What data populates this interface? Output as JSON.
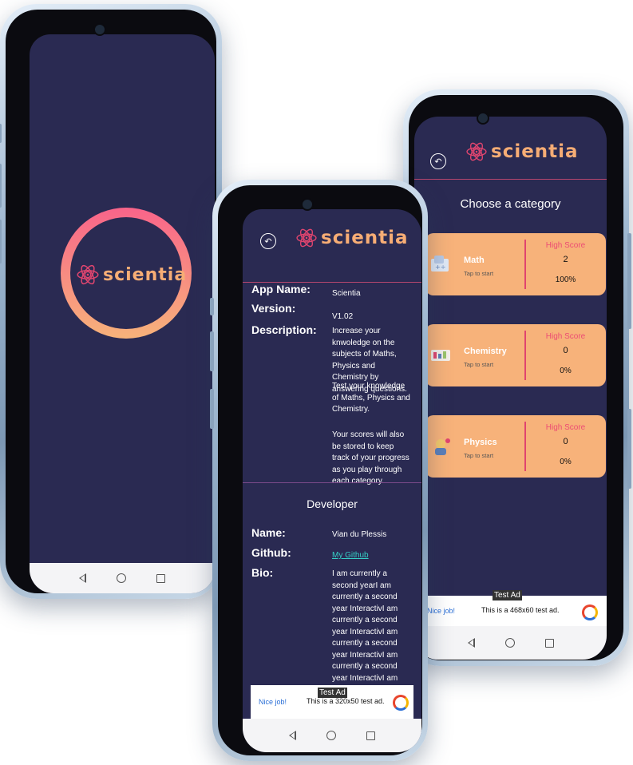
{
  "splash": {
    "logo_text": "scientia",
    "colors": {
      "background": "#2a2a52",
      "ring_start": "#f9648a",
      "ring_end": "#f7b27a",
      "logo": "#f7ad75"
    }
  },
  "info_screen": {
    "logo_text": "scientia",
    "back_icon": "back-arrow-icon",
    "fields": [
      {
        "key": "App Name:",
        "value": "Scientia"
      },
      {
        "key": "Version:",
        "value": "V1.02"
      },
      {
        "key": "Description:",
        "value": "Increase your knwoledge on the subjects of Maths, Physics and Chemistry by answering questions."
      }
    ],
    "description_p2": "Test your knowledge of Maths, Physics and Chemistry.",
    "description_p3": "Your scores will also be stored to keep track of your progress as you play through each category.",
    "developer_heading": "Developer",
    "developer": {
      "name_key": "Name:",
      "name_value": "Vian du Plessis",
      "github_key": "Github:",
      "github_value": "My Github",
      "bio_key": "Bio:",
      "bio_value": "I am currently a second yearI am currently a second year InteractivI am currently a second year InteractivI am currently a second year InteractivI am currently a second year InteractivI am currently a second year InteractivI am"
    },
    "ad": {
      "tag": "Test Ad",
      "nice": "Nice job!",
      "text": "This is a 320x50 test ad."
    }
  },
  "category_screen": {
    "logo_text": "scientia",
    "back_icon": "back-arrow-icon",
    "title": "Choose a category",
    "categories": [
      {
        "name": "Math",
        "tap": "Tap to start",
        "hs_label": "High Score",
        "score": "2",
        "percent": "100%",
        "icon": "math-icon"
      },
      {
        "name": "Chemistry",
        "tap": "Tap to start",
        "hs_label": "High Score",
        "score": "0",
        "percent": "0%",
        "icon": "chemistry-icon"
      },
      {
        "name": "Physics",
        "tap": "Tap to start",
        "hs_label": "High Score",
        "score": "0",
        "percent": "0%",
        "icon": "physics-icon"
      }
    ],
    "ad": {
      "tag": "Test Ad",
      "nice": "Nice job!",
      "text": "This is a 468x60 test ad."
    }
  }
}
